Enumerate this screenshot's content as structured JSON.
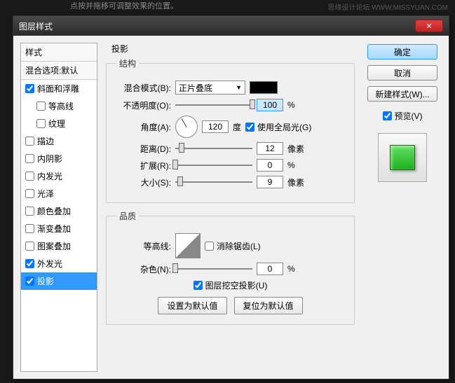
{
  "bg_text": "点按并拖移可调整效果的位置。",
  "watermark": "思缘设计论坛  WWW.MISSYUAN.COM",
  "dialog": {
    "title": "图层样式",
    "close": "✕"
  },
  "left": {
    "header": "样式",
    "subheader": "混合选项:默认",
    "items": [
      {
        "label": "斜面和浮雕",
        "checked": true,
        "indent": false
      },
      {
        "label": "等高线",
        "checked": false,
        "indent": true
      },
      {
        "label": "纹理",
        "checked": false,
        "indent": true
      },
      {
        "label": "描边",
        "checked": false,
        "indent": false
      },
      {
        "label": "内阴影",
        "checked": false,
        "indent": false
      },
      {
        "label": "内发光",
        "checked": false,
        "indent": false
      },
      {
        "label": "光泽",
        "checked": false,
        "indent": false
      },
      {
        "label": "颜色叠加",
        "checked": false,
        "indent": false
      },
      {
        "label": "渐变叠加",
        "checked": false,
        "indent": false
      },
      {
        "label": "图案叠加",
        "checked": false,
        "indent": false
      },
      {
        "label": "外发光",
        "checked": true,
        "indent": false
      },
      {
        "label": "投影",
        "checked": true,
        "indent": false,
        "selected": true
      }
    ]
  },
  "center": {
    "title": "投影",
    "group_structure": "结构",
    "blend_mode_label": "混合模式(B):",
    "blend_mode_value": "正片叠底",
    "opacity_label": "不透明度(O):",
    "opacity_value": "100",
    "opacity_unit": "%",
    "angle_label": "角度(A):",
    "angle_value": "120",
    "angle_unit": "度",
    "global_light_label": "使用全局光(G)",
    "distance_label": "距离(D):",
    "distance_value": "12",
    "spread_label": "扩展(R):",
    "spread_value": "0",
    "size_label": "大小(S):",
    "size_value": "9",
    "px_unit": "像素",
    "pct_unit": "%",
    "group_quality": "品质",
    "contour_label": "等高线:",
    "antialias_label": "消除锯齿(L)",
    "noise_label": "杂色(N):",
    "noise_value": "0",
    "knockout_label": "图层挖空投影(U)",
    "set_default": "设置为默认值",
    "reset_default": "复位为默认值"
  },
  "right": {
    "ok": "确定",
    "cancel": "取消",
    "new_style": "新建样式(W)...",
    "preview": "预览(V)"
  }
}
